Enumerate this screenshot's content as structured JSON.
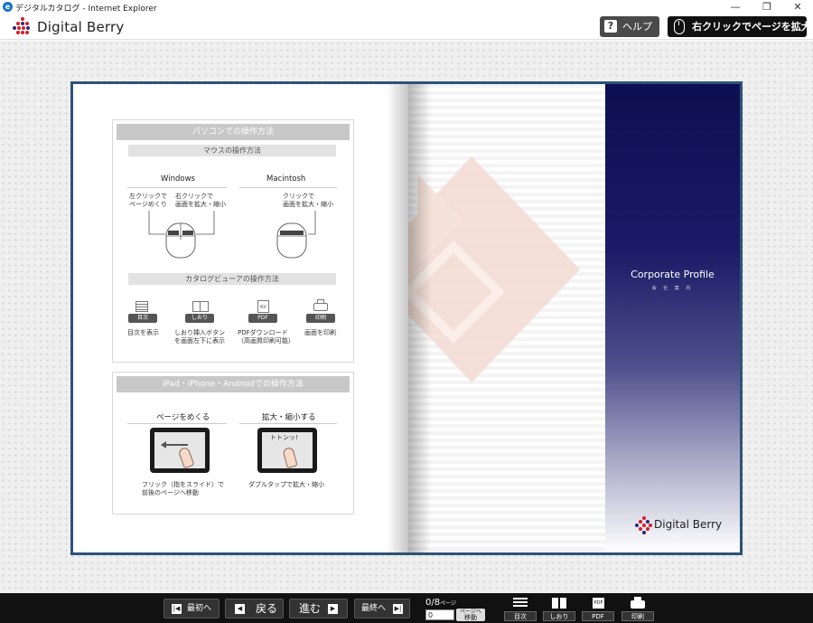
{
  "window": {
    "title": "デジタルカタログ - Internet Explorer",
    "minimize": "—",
    "restore": "❐",
    "close": "✕"
  },
  "header": {
    "logo_text": "Digital Berry",
    "help_label": "ヘルプ",
    "help_icon": "?",
    "zoom_label": "右クリックでページを拡大"
  },
  "left_page": {
    "pc_section": {
      "title": "パソコンでの操作方法",
      "mouse_subtitle": "マウスの操作方法",
      "windows": {
        "title": "Windows",
        "left_click": [
          "左クリックで",
          "ページめくり"
        ],
        "right_click": [
          "右クリックで",
          "画面を拡大・縮小"
        ]
      },
      "mac": {
        "title": "Macintosh",
        "click": [
          "クリックで",
          "画面を拡大・縮小"
        ]
      },
      "viewer_subtitle": "カタログビューアの操作方法",
      "viewer_items": [
        {
          "tag": "目次",
          "desc": [
            "目次を表示"
          ]
        },
        {
          "tag": "しおり",
          "desc": [
            "しおり挿入ボタン",
            "を画面左下に表示"
          ]
        },
        {
          "tag": "PDF",
          "desc": [
            "PDFダウンロード",
            "（高画質印刷可能）"
          ]
        },
        {
          "tag": "印刷",
          "desc": [
            "画面を印刷"
          ]
        }
      ]
    },
    "tablet_section": {
      "title": "iPad・iPhone・Androidでの操作方法",
      "flip": {
        "title": "ページをめくる",
        "desc": [
          "フリック（指をスライド）で",
          "前後のページへ移動"
        ]
      },
      "zoom": {
        "title": "拡大・縮小する",
        "desc": [
          "ダブルタップで拡大・縮小"
        ],
        "screen_text": "トトンッ!"
      }
    }
  },
  "right_page": {
    "cover_title": "Corporate Profile",
    "cover_sub": "会 社 案 内",
    "logo_text": "Digital Berry"
  },
  "bottom": {
    "first_label": "最初へ",
    "back_label": "戻る",
    "next_label": "進む",
    "last_label": "最終へ",
    "page_current": "0",
    "page_total": "/8",
    "page_unit": "ページ",
    "page_input_value": "0",
    "goto_label_1": "ページへ",
    "goto_label_2": "移動",
    "toc_label": "目次",
    "bookmark_label": "しおり",
    "pdf_label": "PDF",
    "print_label": "印刷"
  },
  "colors": {
    "book_frame": "#2b5377",
    "cover_navy": "#0e0e52",
    "brand_red": "#d0202a",
    "diamond_tint": "#f3ddd4"
  }
}
